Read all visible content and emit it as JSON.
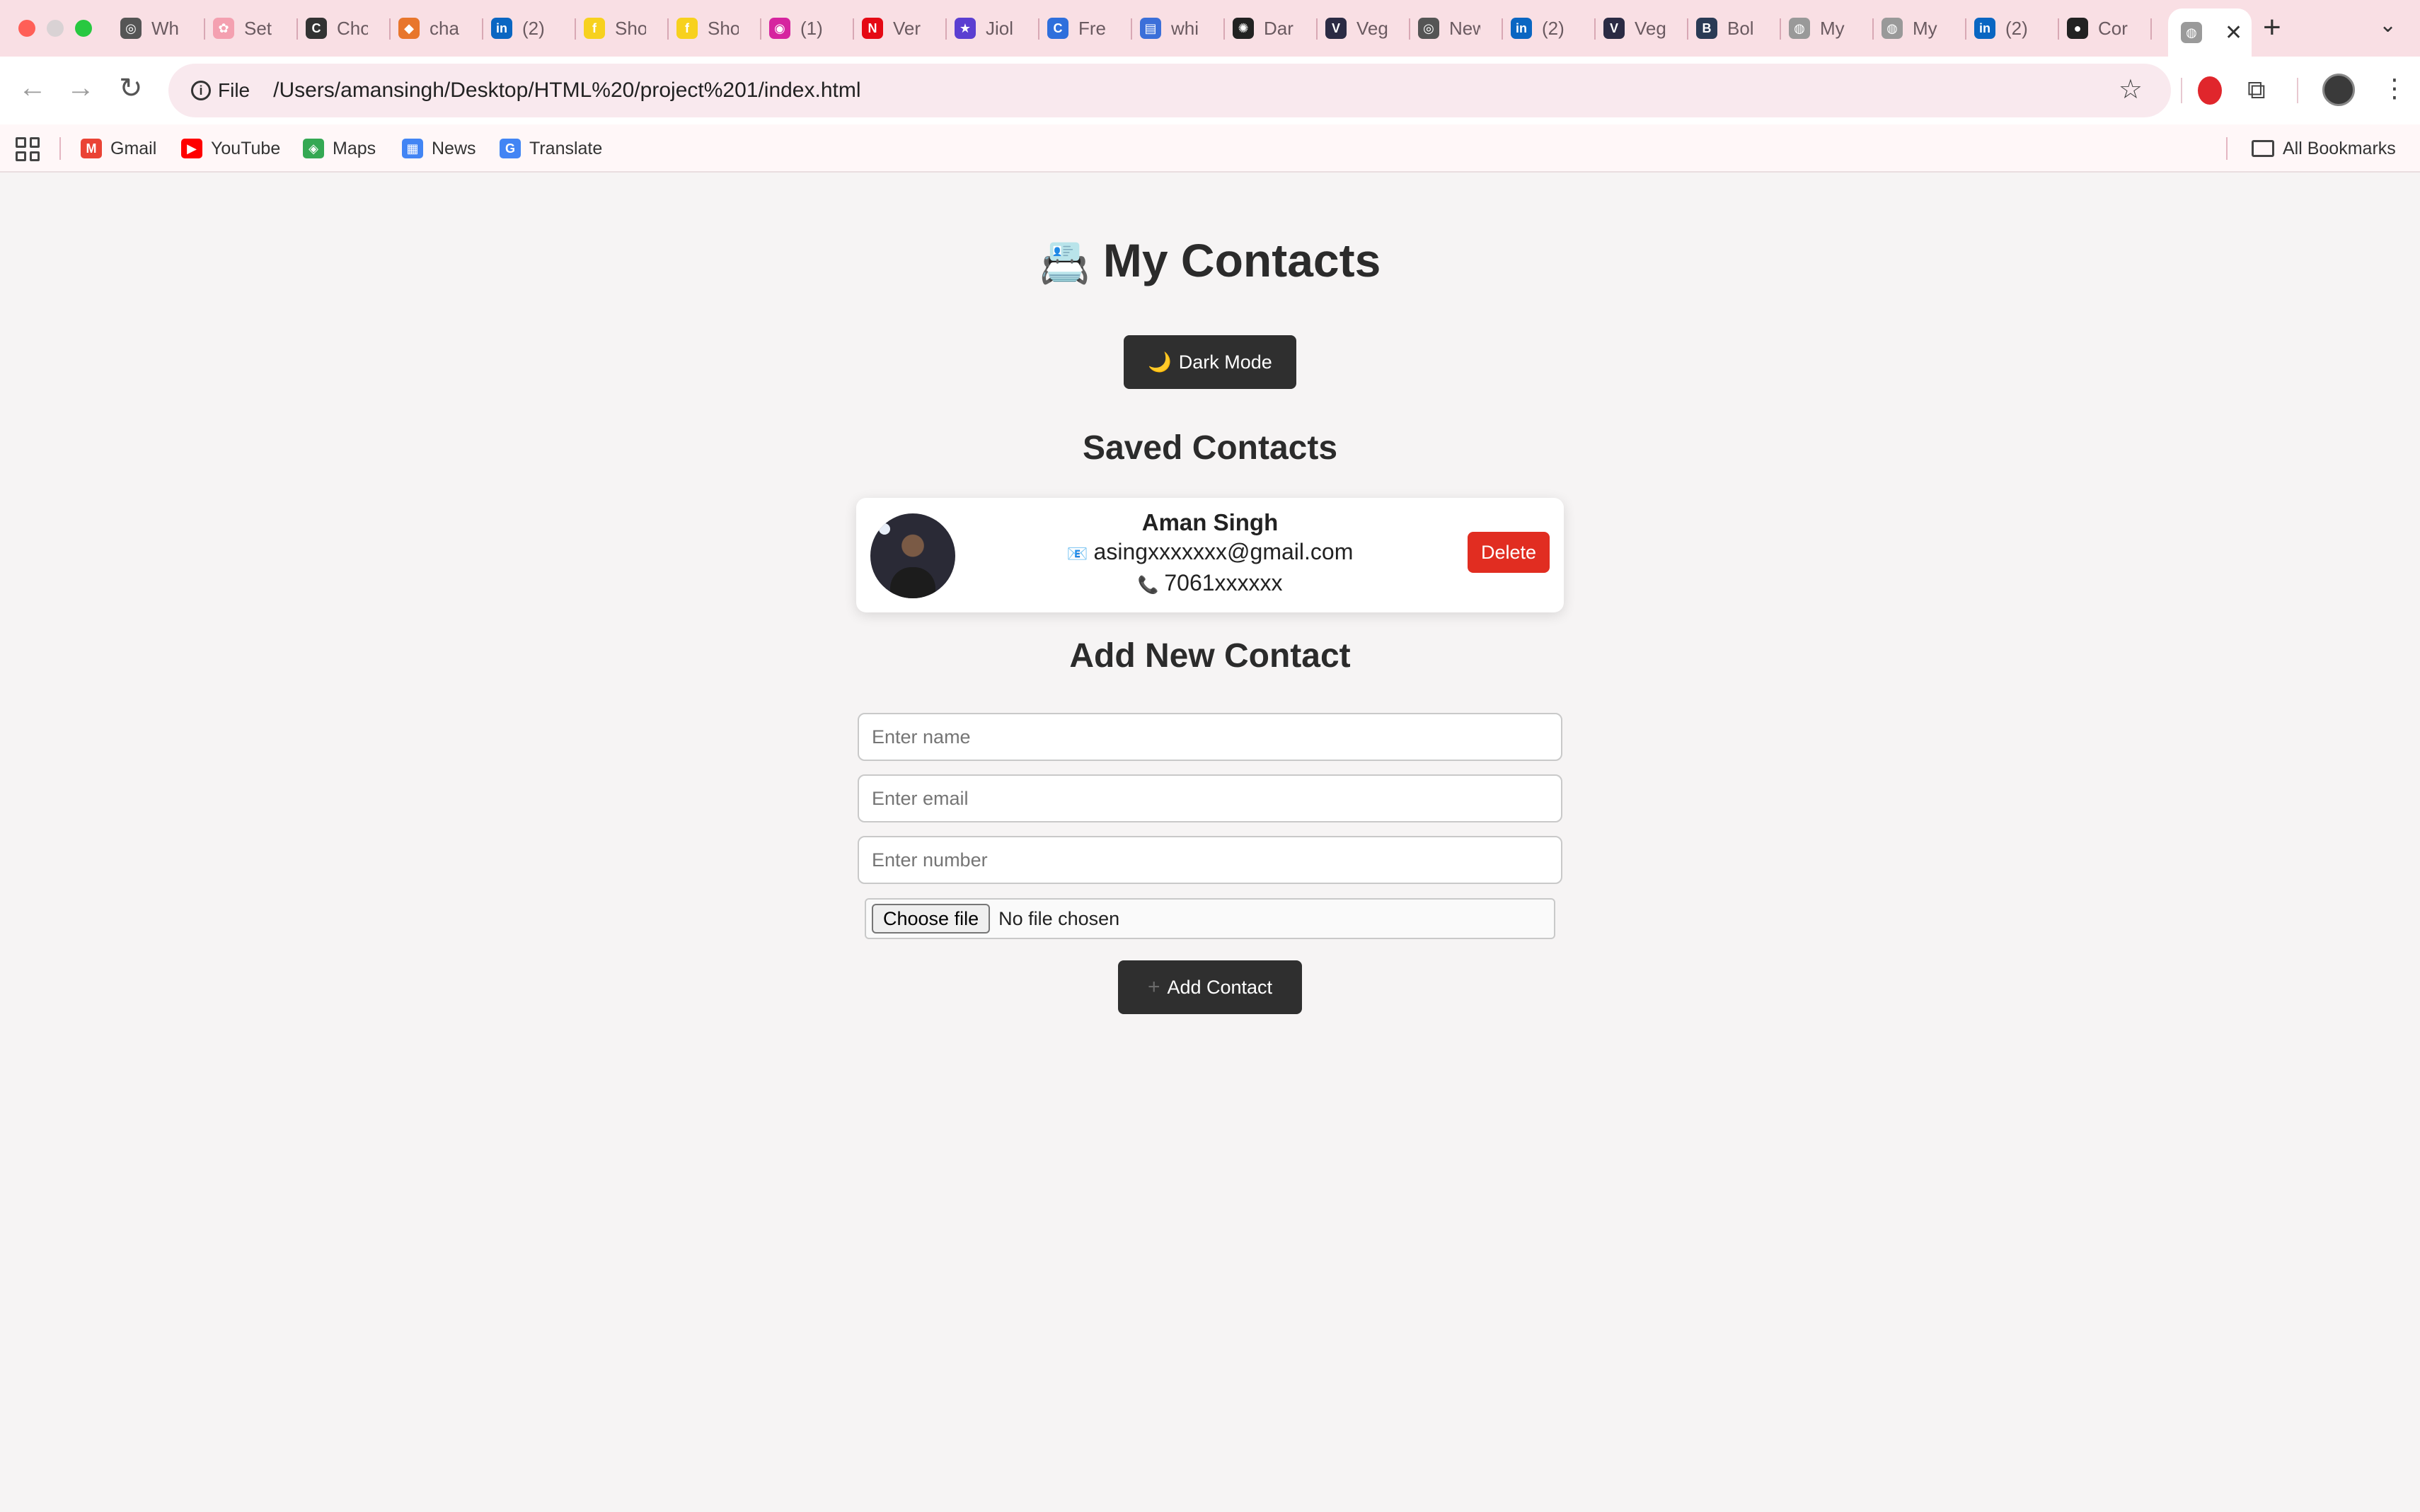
{
  "browser": {
    "tabs": [
      {
        "title": "Wh",
        "icon": "chrome-icon",
        "color": "#555555",
        "glyph": "◎"
      },
      {
        "title": "Set",
        "icon": "settings-flower-icon",
        "color": "#f4a0b0",
        "glyph": "✿"
      },
      {
        "title": "Cho",
        "icon": "chat-icon",
        "color": "#333333",
        "glyph": "C"
      },
      {
        "title": "cha",
        "icon": "game-icon",
        "color": "#e8762c",
        "glyph": "◆"
      },
      {
        "title": "(2)",
        "icon": "linkedin-icon",
        "color": "#0a66c2",
        "glyph": "in"
      },
      {
        "title": "Sho",
        "icon": "flipkart-icon",
        "color": "#f7d11e",
        "glyph": "f"
      },
      {
        "title": "Sho",
        "icon": "flipkart-icon",
        "color": "#f7d11e",
        "glyph": "f"
      },
      {
        "title": "(1)",
        "icon": "instagram-icon",
        "color": "#d6249f",
        "glyph": "◉"
      },
      {
        "title": "Ver",
        "icon": "netflix-icon",
        "color": "#e50914",
        "glyph": "N"
      },
      {
        "title": "Jiol",
        "icon": "jiohotstar-icon",
        "color": "#5b3fd1",
        "glyph": "★"
      },
      {
        "title": "Fre",
        "icon": "web-icon",
        "color": "#2f6fdc",
        "glyph": "C"
      },
      {
        "title": "whi",
        "icon": "printer-icon",
        "color": "#3b6fd9",
        "glyph": "▤"
      },
      {
        "title": "Dar",
        "icon": "openai-icon",
        "color": "#222222",
        "glyph": "✺"
      },
      {
        "title": "Veg",
        "icon": "vercel-v-icon",
        "color": "#2b2b44",
        "glyph": "V"
      },
      {
        "title": "New",
        "icon": "chrome-icon",
        "color": "#555555",
        "glyph": "◎"
      },
      {
        "title": "(2)",
        "icon": "linkedin-icon",
        "color": "#0a66c2",
        "glyph": "in"
      },
      {
        "title": "Veg",
        "icon": "vercel-v-icon",
        "color": "#2b2b44",
        "glyph": "V"
      },
      {
        "title": "Bol",
        "icon": "bolt-icon",
        "color": "#2a3b55",
        "glyph": "B"
      },
      {
        "title": "My",
        "icon": "globe-icon",
        "color": "#999999",
        "glyph": "◍"
      },
      {
        "title": "My",
        "icon": "globe-icon",
        "color": "#999999",
        "glyph": "◍"
      },
      {
        "title": "(2)",
        "icon": "linkedin-icon",
        "color": "#0a66c2",
        "glyph": "in"
      },
      {
        "title": "Cor",
        "icon": "github-icon",
        "color": "#222222",
        "glyph": "●"
      }
    ],
    "active_tab": {
      "icon": "globe-icon",
      "glyph": "◍",
      "close": "✕"
    },
    "new_tab": "+",
    "tab_menu": "⌄",
    "chip_label": "File",
    "url": "/Users/amansingh/Desktop/HTML%20/project%201/index.html",
    "back": "←",
    "forward": "→",
    "reload": "↻",
    "star": "☆",
    "kebab": "⋮",
    "puzzle": "⧉"
  },
  "bookmarks": {
    "items": [
      {
        "label": "Gmail",
        "icon": "gmail-icon",
        "color": "#ea4335",
        "glyph": "M"
      },
      {
        "label": "YouTube",
        "icon": "youtube-icon",
        "color": "#ff0000",
        "glyph": "▶"
      },
      {
        "label": "Maps",
        "icon": "maps-icon",
        "color": "#34a853",
        "glyph": "◈"
      },
      {
        "label": "News",
        "icon": "news-icon",
        "color": "#4285f4",
        "glyph": "▦"
      },
      {
        "label": "Translate",
        "icon": "translate-icon",
        "color": "#4285f4",
        "glyph": "G"
      }
    ],
    "all_bookmarks": "All Bookmarks"
  },
  "page": {
    "title_emoji": "📇",
    "title": "My Contacts",
    "dark_mode_icon": "🌙",
    "dark_mode_label": "Dark Mode",
    "saved_title": "Saved Contacts",
    "contacts": [
      {
        "name": "Aman Singh",
        "email_icon": "📧",
        "email": "asingxxxxxxx@gmail.com",
        "phone_icon": "📞",
        "phone": "7061xxxxxx",
        "delete_label": "Delete"
      }
    ],
    "add_title": "Add New Contact",
    "form": {
      "name_placeholder": "Enter name",
      "email_placeholder": "Enter email",
      "number_placeholder": "Enter number",
      "choose_file": "Choose file",
      "no_file": "No file chosen",
      "add_icon": "+",
      "add_label": "Add Contact"
    },
    "colors": {
      "dark_button": "#2f2f2f",
      "delete_button": "#e12d21",
      "tabstrip": "#f9dfe4"
    }
  }
}
